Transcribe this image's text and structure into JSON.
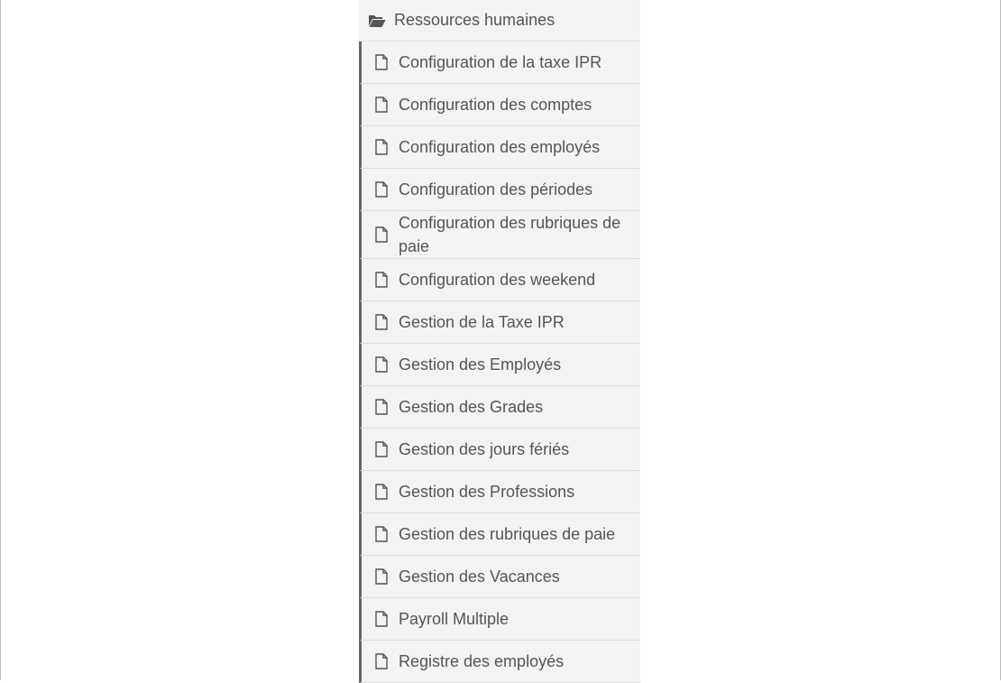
{
  "colors": {
    "panel_bg": "#f3f3f3",
    "text": "#555555",
    "divider": "#dedede",
    "accent_border": "#666666"
  },
  "menu": {
    "header": {
      "label": "Ressources humaines",
      "icon": "folder-open-icon"
    },
    "items": [
      {
        "label": "Configuration de la taxe IPR",
        "icon": "file-icon"
      },
      {
        "label": "Configuration des comptes",
        "icon": "file-icon"
      },
      {
        "label": "Configuration des employés",
        "icon": "file-icon"
      },
      {
        "label": "Configuration des périodes",
        "icon": "file-icon"
      },
      {
        "label": "Configuration des rubriques de paie",
        "icon": "file-icon"
      },
      {
        "label": "Configuration des weekend",
        "icon": "file-icon"
      },
      {
        "label": "Gestion de la Taxe IPR",
        "icon": "file-icon"
      },
      {
        "label": "Gestion des Employés",
        "icon": "file-icon"
      },
      {
        "label": "Gestion des Grades",
        "icon": "file-icon"
      },
      {
        "label": "Gestion des jours fériés",
        "icon": "file-icon"
      },
      {
        "label": "Gestion des Professions",
        "icon": "file-icon"
      },
      {
        "label": "Gestion des rubriques de paie",
        "icon": "file-icon"
      },
      {
        "label": "Gestion des Vacances",
        "icon": "file-icon"
      },
      {
        "label": "Payroll Multiple",
        "icon": "file-icon"
      },
      {
        "label": "Registre des employés",
        "icon": "file-icon"
      }
    ]
  }
}
